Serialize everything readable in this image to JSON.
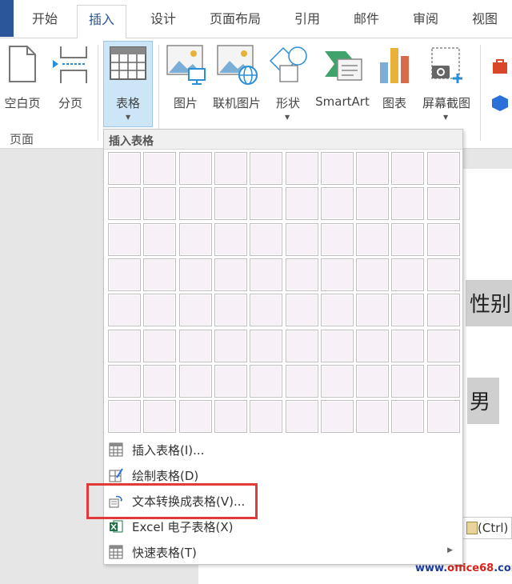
{
  "tabs": [
    "开始",
    "插入",
    "设计",
    "页面布局",
    "引用",
    "邮件",
    "审阅",
    "视图"
  ],
  "active_tab": "插入",
  "ribbon": {
    "blank_page": "空白页",
    "page_break": "分页",
    "table": "表格",
    "pictures": "图片",
    "online_pictures": "联机图片",
    "shapes": "形状",
    "smartart": "SmartArt",
    "chart": "图表",
    "screenshot": "屏幕截图",
    "group_pages": "页面"
  },
  "dropdown": {
    "header": "插入表格",
    "grid": {
      "columns": 10,
      "rows": 8
    },
    "items": [
      {
        "label": "插入表格(I)...",
        "icon": "table-icon"
      },
      {
        "label": "绘制表格(D)",
        "icon": "draw-table-icon"
      },
      {
        "label": "文本转换成表格(V)...",
        "icon": "convert-text-icon"
      },
      {
        "label": "Excel 电子表格(X)",
        "icon": "excel-icon"
      },
      {
        "label": "快速表格(T)",
        "icon": "quick-table-icon"
      }
    ]
  },
  "document": {
    "cell1": "性别",
    "cell2": "男",
    "paste_options": "(Ctrl)"
  },
  "watermark": {
    "prefix": "www.",
    "name": "office68",
    "suffix": ".com"
  },
  "colors": {
    "accent": "#2b579a",
    "highlight": "#e03a3a"
  }
}
